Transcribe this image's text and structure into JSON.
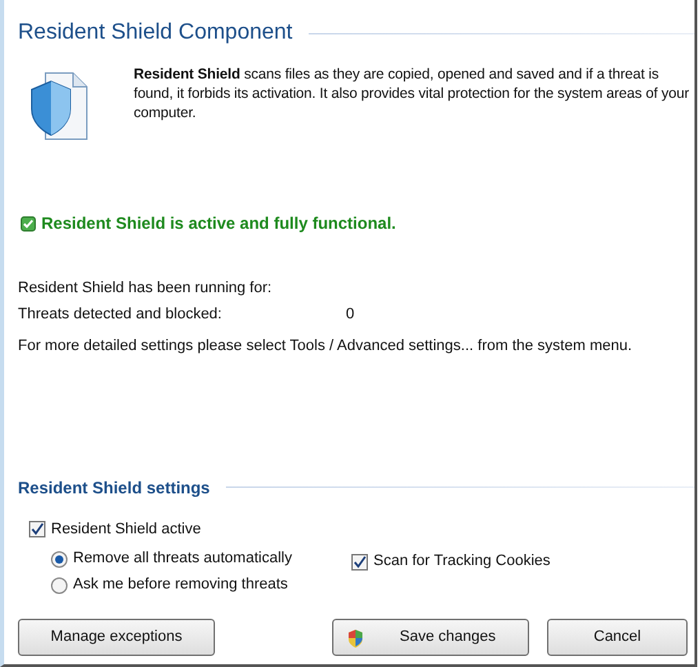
{
  "header": {
    "title": "Resident Shield Component",
    "description": "**Resident Shield** scans files as they are copied, opened and saved and if a threat is found, it forbids its activation. It also provides vital protection for the system areas of your computer."
  },
  "status": {
    "text": "Resident Shield is active and fully functional.",
    "ok": true
  },
  "stats": [
    {
      "label": "Resident Shield has been running for:"
    },
    {
      "label": "Threats detected and blocked:",
      "value": "0"
    }
  ],
  "note": "For more detailed settings please select Tools / Advanced settings... from the system menu.",
  "settings": {
    "title": "Resident Shield settings",
    "active": {
      "label": "Resident Shield active",
      "checked": true
    },
    "actions": [
      {
        "label": "Remove all threats automatically",
        "selected": true
      },
      {
        "label": "Ask me before removing threats",
        "selected": false
      }
    ],
    "cookies": {
      "label": "Scan for Tracking Cookies",
      "checked": true
    }
  },
  "buttons": [
    {
      "label": "Manage exceptions",
      "kind": "plain"
    },
    {
      "label": "Save changes",
      "kind": "shield"
    },
    {
      "label": "Cancel",
      "kind": "plain"
    }
  ]
}
